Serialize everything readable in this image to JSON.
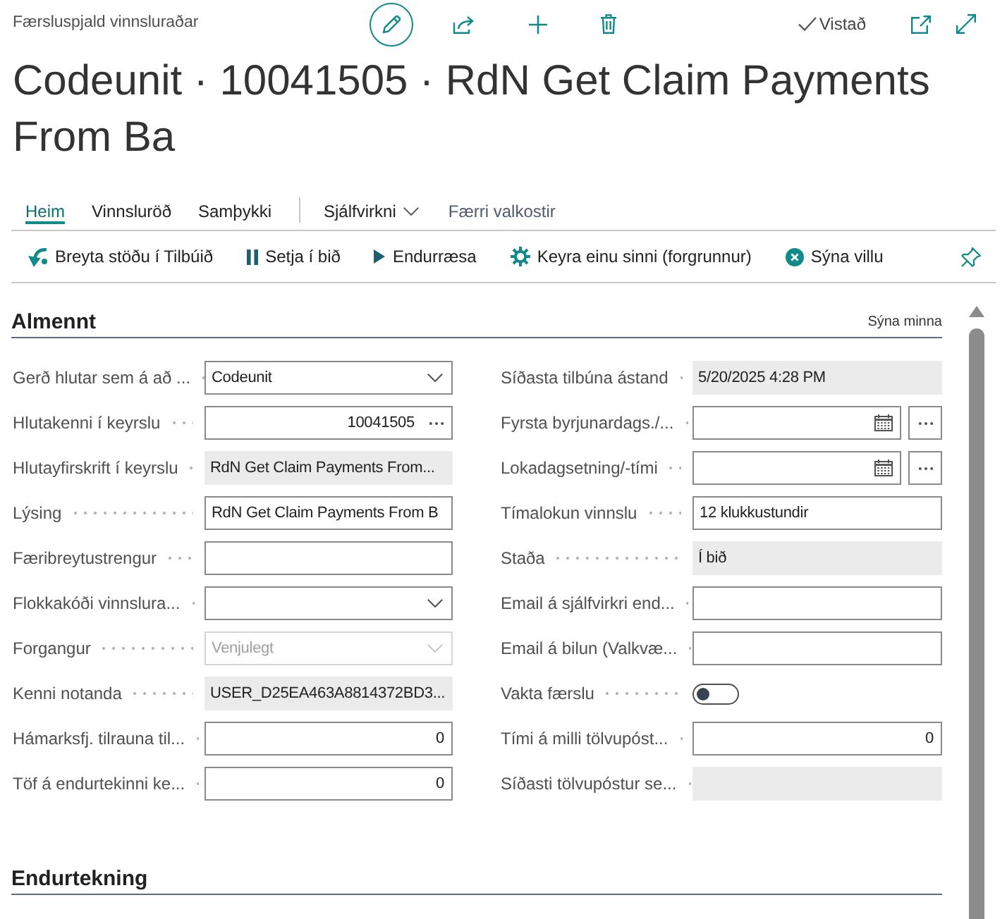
{
  "header": {
    "breadcrumb": "Færsluspjald vinnsluraðar",
    "save_status": "Vistað",
    "title": "Codeunit · 10041505 · RdN Get Claim Payments From Ba"
  },
  "tabs": [
    {
      "label": "Heim",
      "kind": "tab",
      "selected": true
    },
    {
      "label": "Vinnsluröð",
      "kind": "tab",
      "selected": false
    },
    {
      "label": "Samþykki",
      "kind": "tab",
      "selected": false
    },
    {
      "label": "Sjálfvirkni",
      "kind": "menu",
      "selected": false
    }
  ],
  "fewer_options_link": "Færri valkostir",
  "actions": [
    {
      "label": "Breyta stöðu í Tilbúið"
    },
    {
      "label": "Setja í bið"
    },
    {
      "label": "Endurræsa"
    },
    {
      "label": "Keyra einu sinni (forgrunnur)"
    },
    {
      "label": "Sýna villu"
    }
  ],
  "sections": [
    {
      "title": "Almennt",
      "toggle_label": "Sýna minna",
      "columns": [
        [
          {
            "label": "Gerð hlutar sem á að ...",
            "kind": "dropdown",
            "value": "Codeunit",
            "disabled": false
          },
          {
            "label": "Hlutakenni í keyrslu",
            "kind": "lookup",
            "value": "10041505",
            "disabled": false
          },
          {
            "label": "Hlutayfirskrift í keyrslu",
            "kind": "readonly",
            "value": "RdN Get Claim Payments From...",
            "disabled": false
          },
          {
            "label": "Lýsing",
            "kind": "text",
            "value": "RdN Get Claim Payments From B",
            "disabled": false
          },
          {
            "label": "Færibreytustrengur",
            "kind": "text",
            "disabled": false
          },
          {
            "label": "Flokkakóði vinnslura...",
            "kind": "dropdown",
            "disabled": false
          },
          {
            "label": "Forgangur",
            "kind": "dropdown",
            "value": "Venjulegt",
            "disabled": true
          },
          {
            "label": "Kenni notanda",
            "kind": "readonly",
            "value": "USER_D25EA463A8814372BD3...",
            "disabled": false
          },
          {
            "label": "Hámarksfj. tilrauna til...",
            "kind": "number",
            "value": "0",
            "disabled": false
          },
          {
            "label": "Töf á endurtekinni ke...",
            "kind": "number",
            "value": "0",
            "disabled": false
          }
        ],
        [
          {
            "label": "Síðasta tilbúna ástand",
            "kind": "readonly",
            "value": "5/20/2025 4:28 PM",
            "disabled": false
          },
          {
            "label": "Fyrsta byrjunardags./...",
            "kind": "date",
            "disabled": false
          },
          {
            "label": "Lokadagsetning/-tími",
            "kind": "date",
            "disabled": false
          },
          {
            "label": "Tímalokun vinnslu",
            "kind": "text",
            "value": "12 klukkustundir",
            "disabled": false
          },
          {
            "label": "Staða",
            "kind": "readonly",
            "value": "Í bið",
            "disabled": false
          },
          {
            "label": "Email á sjálfvirkri end...",
            "kind": "text",
            "disabled": false
          },
          {
            "label": "Email á bilun (Valkvæ...",
            "kind": "text",
            "disabled": false
          },
          {
            "label": "Vakta færslu",
            "kind": "toggle",
            "on": false,
            "disabled": false
          },
          {
            "label": "Tími á milli tölvupóst...",
            "kind": "number",
            "value": "0",
            "disabled": false
          },
          {
            "label": "Síðasti tölvupóstur se...",
            "kind": "readonly",
            "disabled": false
          }
        ]
      ]
    },
    {
      "title": "Endurtekning"
    }
  ]
}
